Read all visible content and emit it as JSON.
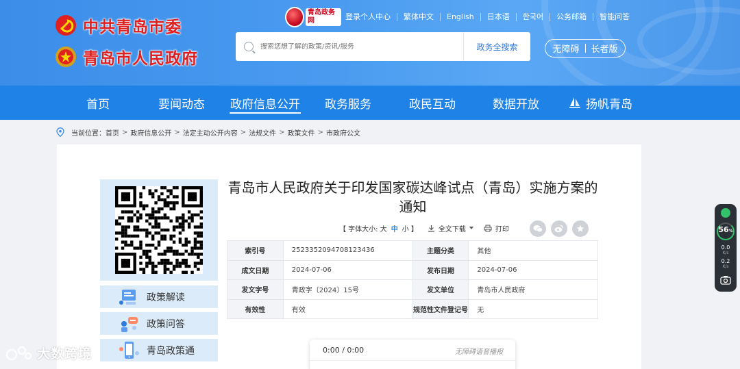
{
  "brand": {
    "party": "中共青岛市委",
    "government": "青岛市人民政府"
  },
  "top_links": {
    "logo_text": "青岛政务网",
    "items": [
      "登录个人中心",
      "繁体中文",
      "English",
      "日本语",
      "한국어",
      "公务邮箱",
      "智能问答"
    ]
  },
  "search": {
    "placeholder": "搜索您想了解的政策/资讯/服务",
    "button": "政务全搜索"
  },
  "accessibility": {
    "barrier_free": "无障碍",
    "elder": "长者版"
  },
  "nav": {
    "items": [
      "首页",
      "要闻动态",
      "政府信息公开",
      "政务服务",
      "政民互动",
      "数据开放",
      "扬帆青岛"
    ],
    "active_index": 2
  },
  "breadcrumb": {
    "prefix": "当前位置：",
    "items": [
      "首页",
      "政府信息公开",
      "法定主动公开内容",
      "法规文件",
      "政策文件",
      "市政府公文"
    ],
    "separator": ">"
  },
  "side": {
    "buttons": [
      "政策解读",
      "政策问答",
      "青岛政策通"
    ]
  },
  "article": {
    "title": "青岛市人民政府关于印发国家碳达峰试点（青岛）实施方案的通知",
    "font_label": "【 字体大小: 大",
    "font_mid": "中",
    "font_small": "小 】",
    "download": "全文下载",
    "print": "打印"
  },
  "meta": {
    "rows": [
      {
        "k1": "索引号",
        "v1": "2523352094708123436",
        "k2": "主题分类",
        "v2": "其他"
      },
      {
        "k1": "成文日期",
        "v1": "2024-07-06",
        "k2": "发布日期",
        "v2": "2024-07-06"
      },
      {
        "k1": "发文字号",
        "v1": "青政字〔2024〕15号",
        "k2": "发文单位",
        "v2": "青岛市人民政府"
      },
      {
        "k1": "有效性",
        "v1": "有效",
        "k2": "规范性文件登记号",
        "v2": "无"
      }
    ]
  },
  "audio": {
    "time": "0:00 / 0:00",
    "label": "无障碍语音播报"
  },
  "widget": {
    "percent": "56",
    "percent_unit": "%",
    "up": "0.0",
    "up_unit": "K/s",
    "down": "0.2",
    "down_unit": "K/s"
  },
  "watermark": {
    "text": "大数跨境"
  },
  "colors": {
    "header": "#4a9bf0",
    "nav": "#1e82e6",
    "brand_red": "#e02020",
    "link_blue": "#2d7ae0"
  }
}
